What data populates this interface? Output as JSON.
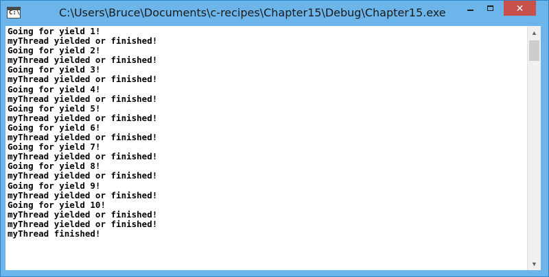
{
  "window": {
    "title": "C:\\Users\\Bruce\\Documents\\c-recipes\\Chapter15\\Debug\\Chapter15.exe",
    "colors": {
      "frame": "#6cb5eb",
      "close": "#c7504b",
      "background": "#ffffff",
      "text": "#000000"
    }
  },
  "controls": {
    "minimize_icon": "minimize-icon",
    "maximize_icon": "maximize-icon",
    "close_symbol": "✕"
  },
  "icons": {
    "app_prompt": "C:\\",
    "scroll_up": "▲",
    "scroll_down": "▼"
  },
  "console": {
    "lines": [
      "Going for yield 1!",
      "myThread yielded or finished!",
      "Going for yield 2!",
      "myThread yielded or finished!",
      "Going for yield 3!",
      "myThread yielded or finished!",
      "Going for yield 4!",
      "myThread yielded or finished!",
      "Going for yield 5!",
      "myThread yielded or finished!",
      "Going for yield 6!",
      "myThread yielded or finished!",
      "Going for yield 7!",
      "myThread yielded or finished!",
      "Going for yield 8!",
      "myThread yielded or finished!",
      "Going for yield 9!",
      "myThread yielded or finished!",
      "Going for yield 10!",
      "myThread yielded or finished!",
      "myThread yielded or finished!",
      "myThread finished!"
    ]
  }
}
